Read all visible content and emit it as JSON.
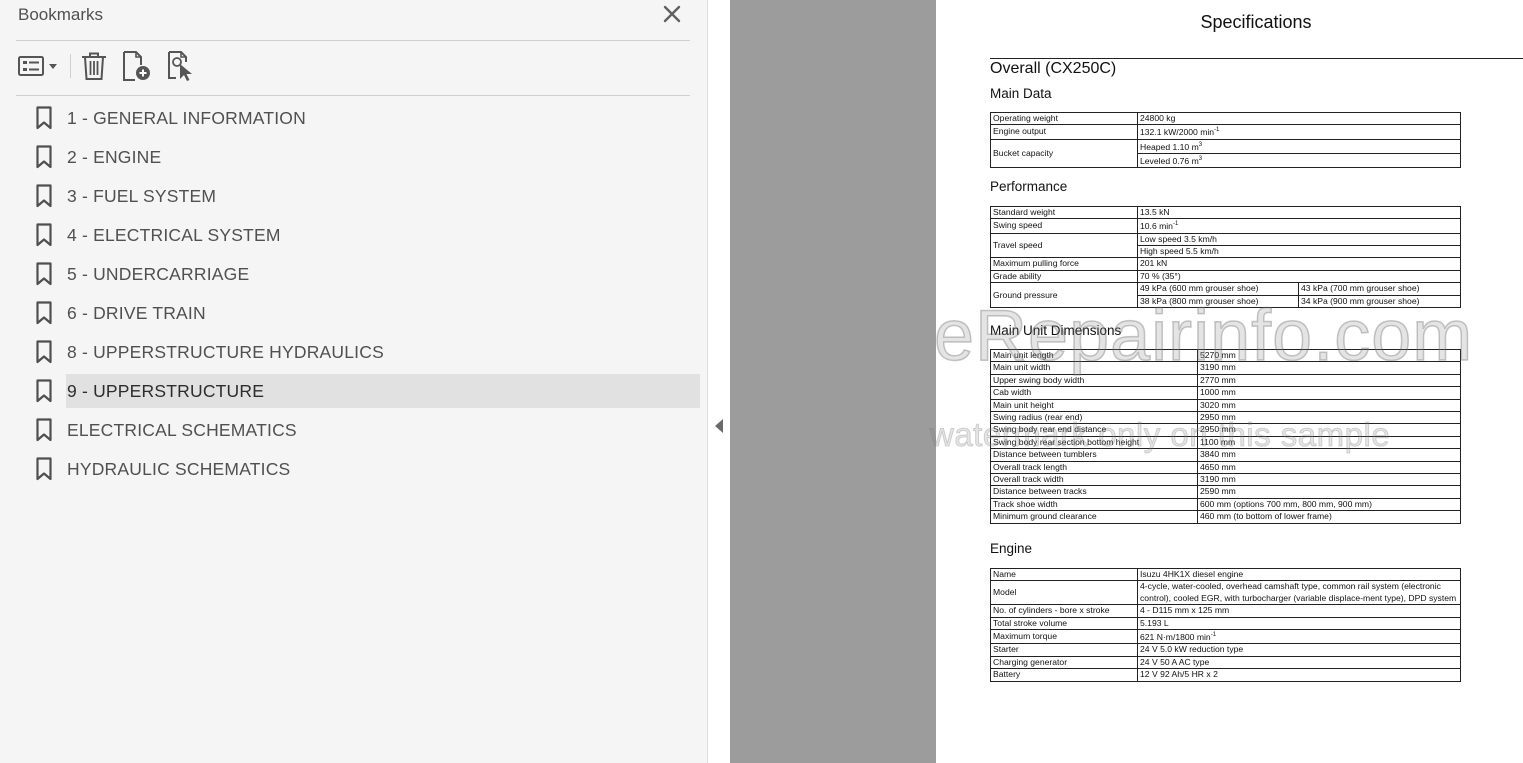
{
  "bookmarks_panel": {
    "title": "Bookmarks",
    "toolbar_icons": [
      "options-menu-icon",
      "delete-bookmark-icon",
      "new-bookmark-icon",
      "bookmark-from-selection-icon"
    ],
    "items": [
      {
        "label": "1 - GENERAL INFORMATION",
        "selected": false
      },
      {
        "label": "2 - ENGINE",
        "selected": false
      },
      {
        "label": "3 - FUEL SYSTEM",
        "selected": false
      },
      {
        "label": "4 - ELECTRICAL SYSTEM",
        "selected": false
      },
      {
        "label": "5 - UNDERCARRIAGE",
        "selected": false
      },
      {
        "label": "6 - DRIVE TRAIN",
        "selected": false
      },
      {
        "label": "8 - UPPERSTRUCTURE HYDRAULICS",
        "selected": false
      },
      {
        "label": "9 - UPPERSTRUCTURE",
        "selected": true
      },
      {
        "label": "ELECTRICAL SCHEMATICS",
        "selected": false
      },
      {
        "label": "HYDRAULIC SCHEMATICS",
        "selected": false
      }
    ]
  },
  "document": {
    "title": "Specifications",
    "overall_heading": "Overall (CX250C)",
    "main_data": {
      "heading": "Main Data",
      "operating_weight": {
        "label": "Operating weight",
        "value": "24800 kg"
      },
      "engine_output": {
        "label": "Engine output",
        "value": "132.1 kW/2000 min",
        "sup": "-1"
      },
      "bucket_capacity": {
        "label": "Bucket capacity",
        "heaped": "Heaped 1.10 m",
        "leveled": "Leveled 0.76 m",
        "sup": "3"
      }
    },
    "performance": {
      "heading": "Performance",
      "standard_weight": {
        "label": "Standard weight",
        "value": "13.5 kN"
      },
      "swing_speed": {
        "label": "Swing speed",
        "value": "10.6 min",
        "sup": "-1"
      },
      "travel_speed": {
        "label": "Travel speed",
        "low": "Low speed 3.5 km/h",
        "high": "High speed 5.5 km/h"
      },
      "max_pulling_force": {
        "label": "Maximum pulling force",
        "value": "201 kN"
      },
      "grade_ability": {
        "label": "Grade ability",
        "value": "70 % (35°)"
      },
      "ground_pressure": {
        "label": "Ground pressure",
        "v1": "49 kPa (600 mm grouser shoe)",
        "v2": "43 kPa (700 mm grouser shoe)",
        "v3": "38 kPa (800 mm grouser shoe)",
        "v4": "34 kPa (900 mm grouser shoe)"
      }
    },
    "dimensions": {
      "heading": "Main Unit Dimensions",
      "rows": [
        {
          "label": "Main unit length",
          "value": "5270 mm"
        },
        {
          "label": "Main unit width",
          "value": "3190 mm"
        },
        {
          "label": "Upper swing body width",
          "value": "2770 mm"
        },
        {
          "label": "Cab width",
          "value": "1000 mm"
        },
        {
          "label": "Main unit height",
          "value": "3020 mm"
        },
        {
          "label": "Swing radius (rear end)",
          "value": "2950 mm"
        },
        {
          "label": "Swing body rear end distance",
          "value": "2950 mm"
        },
        {
          "label": "Swing body rear section bottom height",
          "value": "1100 mm"
        },
        {
          "label": "Distance between tumblers",
          "value": "3840 mm"
        },
        {
          "label": "Overall track length",
          "value": "4650 mm"
        },
        {
          "label": "Overall track width",
          "value": "3190 mm"
        },
        {
          "label": "Distance between tracks",
          "value": "2590 mm"
        },
        {
          "label": "Track shoe width",
          "value": "600 mm (options 700 mm, 800 mm, 900 mm)"
        },
        {
          "label": "Minimum ground clearance",
          "value": "460 mm (to bottom of lower frame)"
        }
      ]
    },
    "engine": {
      "heading": "Engine",
      "name": {
        "label": "Name",
        "value": "Isuzu 4HK1X diesel engine"
      },
      "model": {
        "label": "Model",
        "value": "4-cycle, water-cooled, overhead camshaft type, common rail system (electronic control), cooled EGR, with turbocharger (variable displace-ment type), DPD system"
      },
      "cylinders": {
        "label": "No. of cylinders - bore x stroke",
        "value": "4 - D115 mm x 125 mm"
      },
      "stroke_volume": {
        "label": "Total stroke volume",
        "value": "5.193 L"
      },
      "max_torque": {
        "label": "Maximum torque",
        "value": "621 N·m/1800 min",
        "sup": "-1"
      },
      "starter": {
        "label": "Starter",
        "value": "24 V 5.0 kW reduction type"
      },
      "charging_generator": {
        "label": "Charging generator",
        "value": "24 V 50 A AC type"
      },
      "battery": {
        "label": "Battery",
        "value": "12 V 92 Ah/5 HR x 2"
      }
    }
  },
  "watermark": {
    "main": "eRepairinfo.com",
    "sub": "watermark only on this sample"
  },
  "colors": {
    "sidebar_bg": "#f5f5f5",
    "selected_bg": "#e1e1e1",
    "gutter": "#9c9c9c",
    "text": "#505050"
  }
}
